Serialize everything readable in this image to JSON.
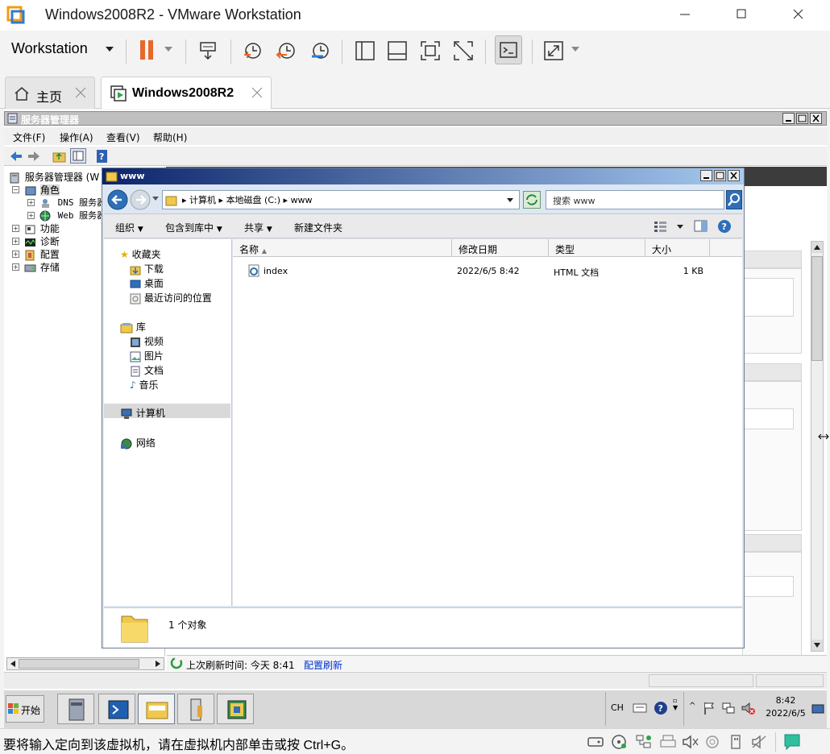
{
  "vm_window": {
    "title": "Windows2008R2 - VMware Workstation",
    "workstation_menu": "Workstation",
    "tabs": [
      {
        "label": "主页"
      },
      {
        "label": "Windows2008R2"
      }
    ]
  },
  "server_manager": {
    "title": "服务器管理器",
    "menu": [
      "文件(F)",
      "操作(A)",
      "查看(V)",
      "帮助(H)"
    ],
    "tree": {
      "root": "服务器管理器 (W",
      "roles": "角色",
      "dns": "DNS 服务器",
      "web": "Web 服务器",
      "features": "功能",
      "diagnostics": "诊断",
      "config": "配置",
      "storage": "存储"
    },
    "status": {
      "last_refresh": "上次刷新时间: 今天 8:41",
      "config_refresh": "配置刷新"
    }
  },
  "explorer": {
    "title": "www",
    "breadcrumb": [
      "计算机",
      "本地磁盘 (C:)",
      "www"
    ],
    "search_placeholder": "搜索 www",
    "commands": {
      "organize": "组织",
      "include_in_library": "包含到库中",
      "share": "共享",
      "new_folder": "新建文件夹"
    },
    "nav": {
      "favorites": "收藏夹",
      "downloads": "下载",
      "desktop": "桌面",
      "recent": "最近访问的位置",
      "libraries": "库",
      "videos": "视频",
      "pictures": "图片",
      "documents": "文档",
      "music": "音乐",
      "computer": "计算机",
      "network": "网络"
    },
    "columns": [
      "名称",
      "修改日期",
      "类型",
      "大小"
    ],
    "files": [
      {
        "name": "index",
        "modified": "2022/6/5 8:42",
        "type": "HTML 文档",
        "size": "1 KB"
      }
    ],
    "details": "1 个对象"
  },
  "taskbar": {
    "start": "开始",
    "lang": "CH",
    "clock_time": "8:42",
    "clock_date": "2022/6/5"
  },
  "vm_status": {
    "message": "要将输入定向到该虚拟机，请在虚拟机内部单击或按 Ctrl+G。"
  },
  "colors": {
    "explorer_title_start": "#0b246a",
    "explorer_title_end": "#a6caf0",
    "pause_orange": "#e8682a",
    "link_blue": "#0033cc"
  }
}
